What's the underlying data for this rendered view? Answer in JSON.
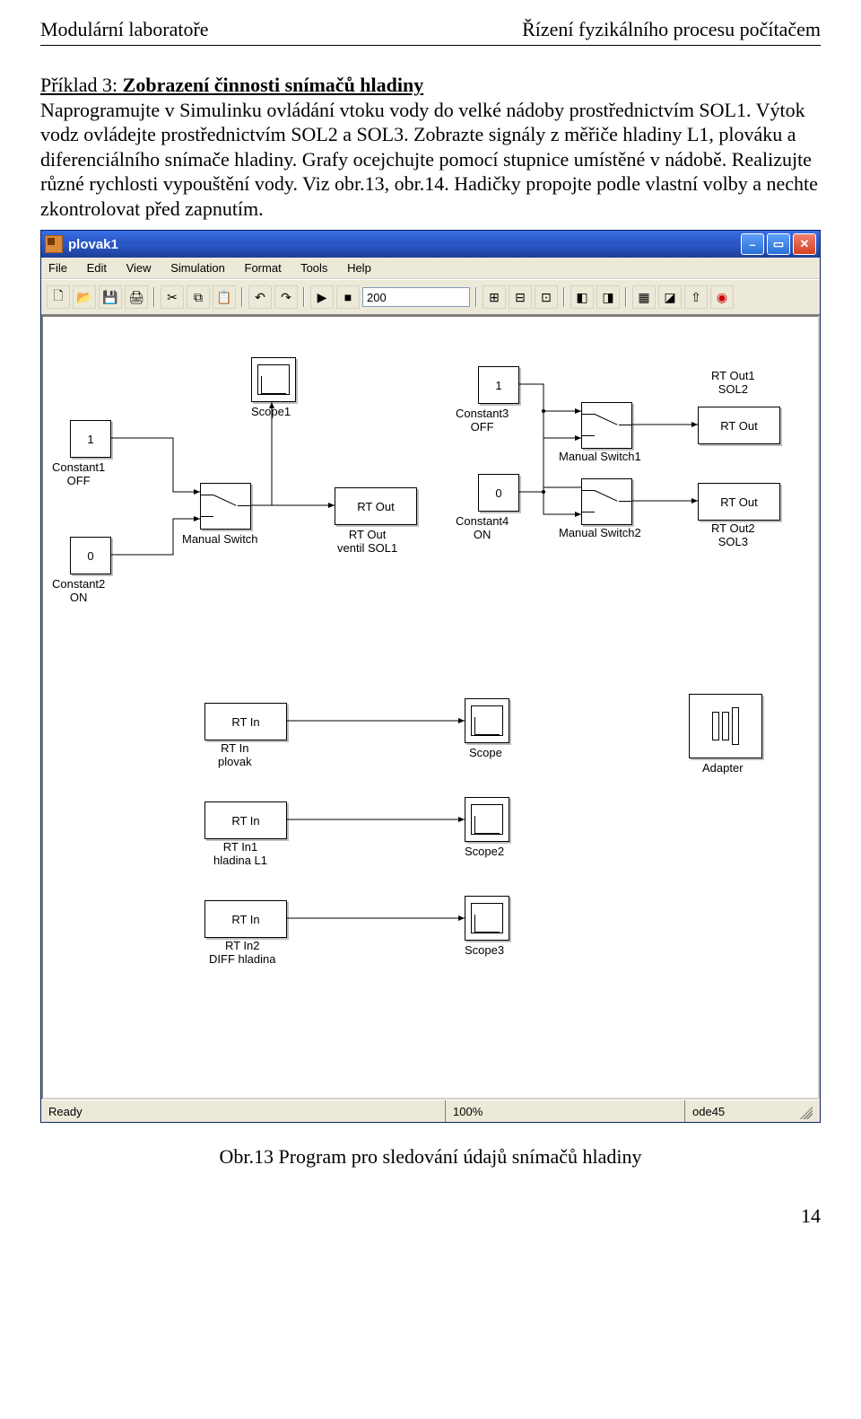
{
  "header": {
    "left": "Modulární laboratoře",
    "right": "Řízení fyzikálního procesu počítačem"
  },
  "para": {
    "lead": "Příklad 3: ",
    "title": "Zobrazení činnosti snímačů hladiny",
    "body": "Naprogramujte v Simulinku ovládání vtoku vody do velké nádoby prostřednictvím SOL1. Výtok vodz ovládejte prostřednictvím SOL2 a SOL3. Zobrazte signály z měřiče hladiny L1, plováku a diferenciálního snímače hladiny. Grafy ocejchujte pomocí stupnice umístěné v nádobě. Realizujte různé rychlosti vypouštění vody. Viz obr.13, obr.14. Hadičky propojte podle vlastní volby a nechte zkontrolovat před zapnutím."
  },
  "window": {
    "title": "plovak1",
    "menu": [
      "File",
      "Edit",
      "View",
      "Simulation",
      "Format",
      "Tools",
      "Help"
    ],
    "stoptime": "200",
    "status": {
      "ready": "Ready",
      "zoom": "100%",
      "solver": "ode45"
    }
  },
  "blocks": {
    "const1": {
      "val": "1",
      "label1": "Constant1",
      "label2": "OFF"
    },
    "const2": {
      "val": "0",
      "label1": "Constant2",
      "label2": "ON"
    },
    "const3": {
      "val": "1",
      "label1": "Constant3",
      "label2": "OFF"
    },
    "const4": {
      "val": "0",
      "label1": "Constant4",
      "label2": "ON"
    },
    "msw": {
      "label": "Manual Switch"
    },
    "msw1": {
      "label": "Manual Switch1"
    },
    "msw2": {
      "label": "Manual Switch2"
    },
    "scope1": {
      "label": "Scope1"
    },
    "scope": {
      "label": "Scope"
    },
    "scope2": {
      "label": "Scope2"
    },
    "scope3": {
      "label": "Scope3"
    },
    "rtout": {
      "text": "RT Out",
      "label1": "RT Out",
      "label2": "ventil SOL1"
    },
    "rtout1": {
      "text": "RT Out",
      "label1": "RT Out1",
      "label2": "SOL2"
    },
    "rtout2": {
      "text": "RT Out",
      "label1": "RT Out2",
      "label2": "SOL3"
    },
    "rtin": {
      "text": "RT In",
      "label1": "RT In",
      "label2": "plovak"
    },
    "rtin1": {
      "text": "RT In",
      "label1": "RT In1",
      "label2": "hladina L1"
    },
    "rtin2": {
      "text": "RT In",
      "label1": "RT In2",
      "label2": "DIFF hladina"
    },
    "adapter": {
      "label": "Adapter"
    }
  },
  "caption": "Obr.13 Program pro sledování údajů snímačů hladiny",
  "pagenum": "14"
}
